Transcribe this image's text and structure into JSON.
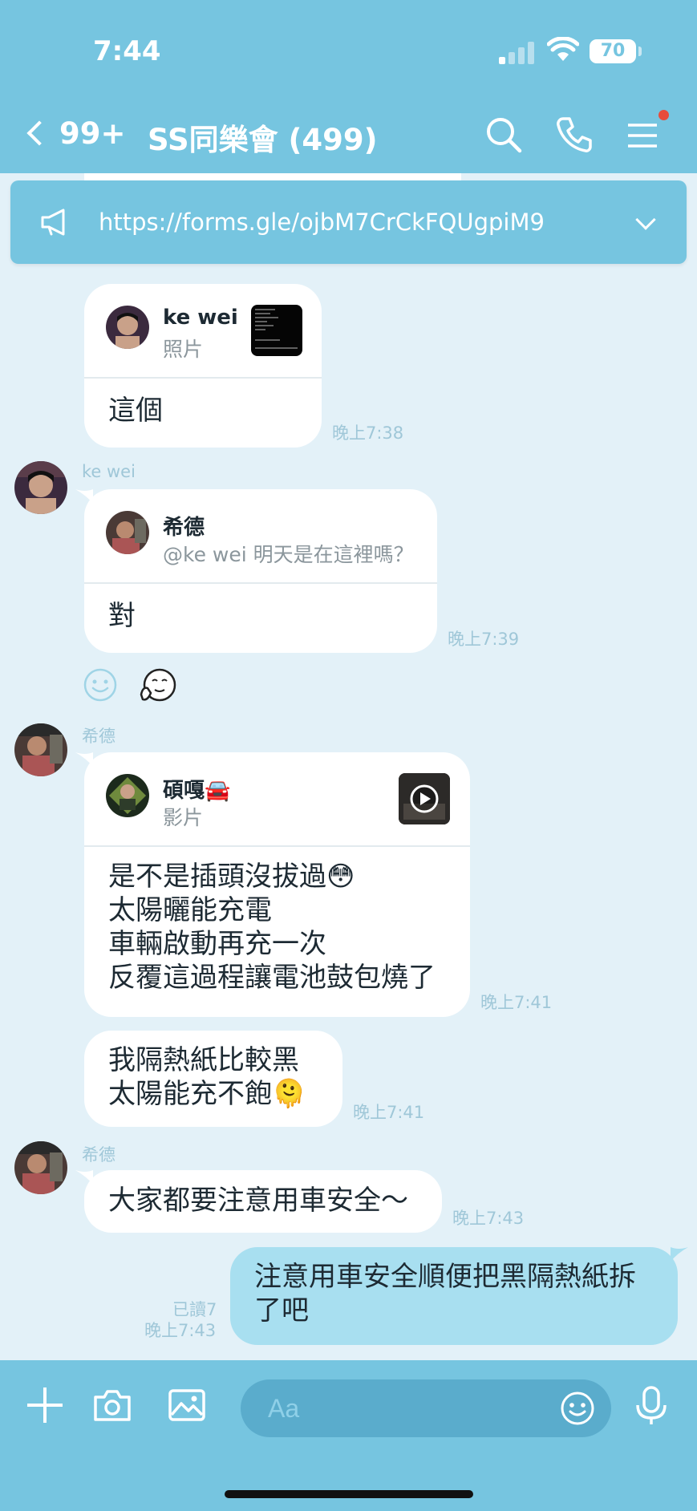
{
  "status": {
    "time": "7:44",
    "battery": "70"
  },
  "header": {
    "back_count": "99+",
    "title": "SS同樂會 (499)"
  },
  "announcement": {
    "text": "https://forms.gle/ojbM7CrCkFQUgpiM9"
  },
  "messages": [
    {
      "reply_to": {
        "name": "ke wei",
        "preview": "照片"
      },
      "text": "這個",
      "time": "晚上7:38"
    },
    {
      "sender": "ke wei",
      "reply_to": {
        "name": "希德",
        "preview": "@ke wei 明天是在這裡嗎？"
      },
      "text": "對",
      "time": "晚上7:39"
    },
    {
      "sender": "希德",
      "reply_to": {
        "name": "碩嘎🚘",
        "preview": "影片"
      },
      "text": "是不是插頭沒拔過😳\n太陽曬能充電\n車輛啟動再充一次\n反覆這過程讓電池鼓包燒了",
      "time": "晚上7:41"
    },
    {
      "text": "我隔熱紙比較黑\n太陽能充不飽🫠",
      "time": "晚上7:41"
    },
    {
      "sender": "希德",
      "text": "大家都要注意用車安全～",
      "time": "晚上7:43"
    },
    {
      "outgoing": true,
      "text": "注意用車安全順便把黑隔熱紙拆\n了吧",
      "read": "已讀7",
      "time": "晚上7:43"
    }
  ],
  "input": {
    "placeholder": "Aa"
  },
  "icons": {
    "search": "search-icon",
    "call": "phone-icon",
    "menu": "menu-icon",
    "announce": "megaphone-icon",
    "add": "plus-icon",
    "camera": "camera-icon",
    "gallery": "image-icon",
    "emoji": "smiley-icon",
    "mic": "microphone-icon"
  },
  "colors": {
    "header": "#76c5e0",
    "chat_bg": "#e3f1f8",
    "outgoing": "#a8dff0",
    "time": "#9fc7d8"
  }
}
